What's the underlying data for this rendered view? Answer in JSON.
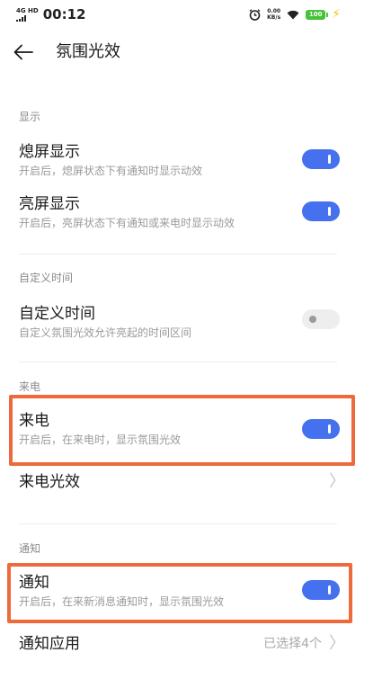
{
  "status_bar": {
    "network": "4G HD",
    "time": "00:12",
    "speed_value": "0.00",
    "speed_unit": "KB/s",
    "battery": "100"
  },
  "header": {
    "title": "氛围光效"
  },
  "sections": {
    "display": {
      "header": "显示",
      "screen_off": {
        "title": "熄屏显示",
        "subtitle": "开启后，熄屏状态下有通知时显示动效",
        "enabled": true
      },
      "screen_on": {
        "title": "亮屏显示",
        "subtitle": "开启后，亮屏状态下有通知或来电时显示动效",
        "enabled": true
      }
    },
    "custom_time": {
      "header": "自定义时间",
      "item": {
        "title": "自定义时间",
        "subtitle": "自定义氛围光效允许亮起的时间区间",
        "enabled": false
      }
    },
    "incoming_call": {
      "header": "来电",
      "toggle_item": {
        "title": "来电",
        "subtitle": "开启后，在来电时，显示氛围光效",
        "enabled": true
      },
      "effect_item": {
        "title": "来电光效"
      }
    },
    "notification": {
      "header": "通知",
      "toggle_item": {
        "title": "通知",
        "subtitle": "开启后，在来新消息通知时，显示氛围光效",
        "enabled": true
      },
      "apps_item": {
        "title": "通知应用",
        "value": "已选择4个"
      }
    }
  },
  "colors": {
    "accent": "#4570ee",
    "highlight": "#ee6a3c",
    "toggle_off": "#eeeeee"
  }
}
